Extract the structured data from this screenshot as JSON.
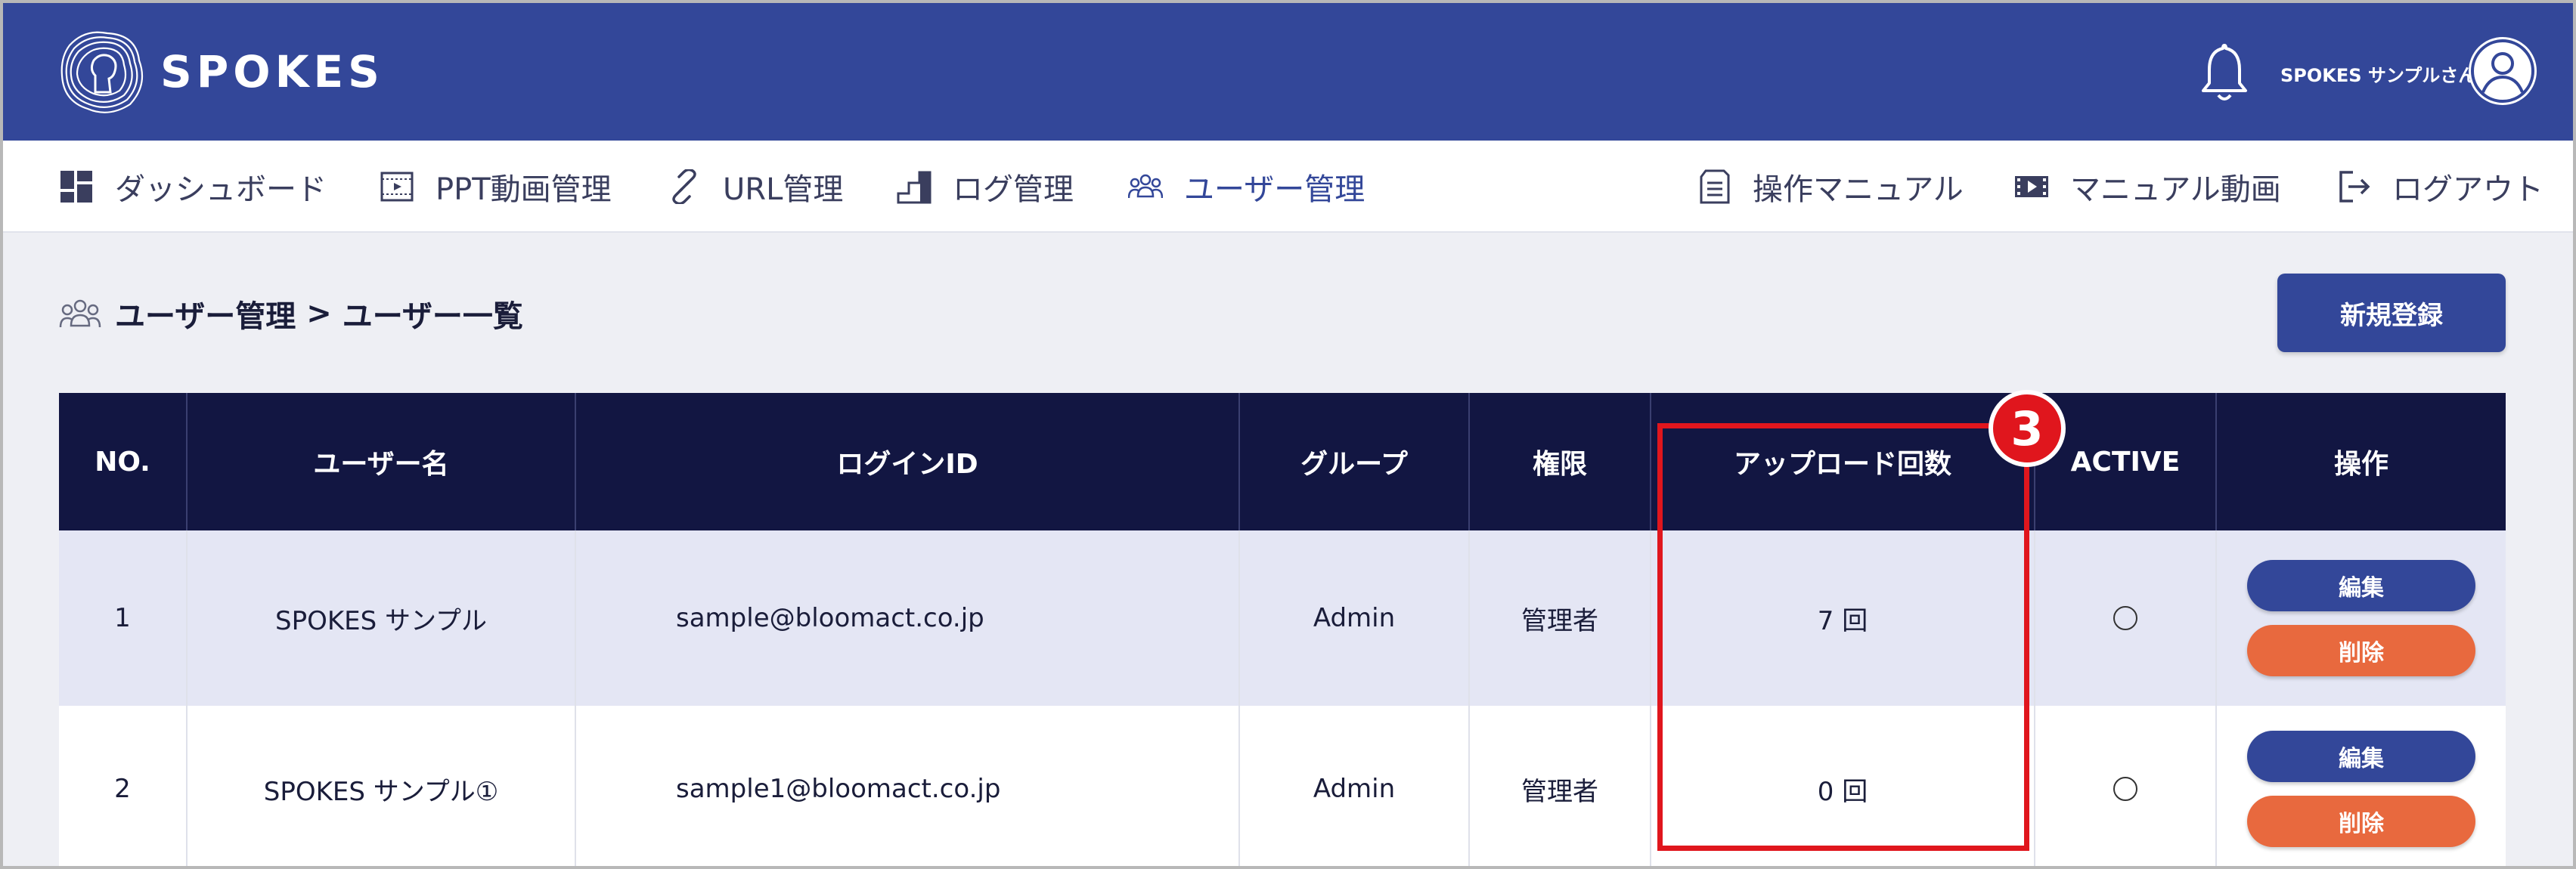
{
  "header": {
    "logo_text": "SPOKES",
    "user_name": "SPOKES サンプルさん"
  },
  "nav": {
    "items": [
      {
        "label": "ダッシュボード",
        "icon": "dashboard-icon"
      },
      {
        "label": "PPT動画管理",
        "icon": "video-file-icon"
      },
      {
        "label": "URL管理",
        "icon": "link-icon"
      },
      {
        "label": "ログ管理",
        "icon": "log-stairs-icon"
      },
      {
        "label": "ユーザー管理",
        "icon": "users-icon",
        "active": true
      }
    ],
    "right_items": [
      {
        "label": "操作マニュアル",
        "icon": "document-icon"
      },
      {
        "label": "マニュアル動画",
        "icon": "film-icon"
      },
      {
        "label": "ログアウト",
        "icon": "logout-icon"
      }
    ]
  },
  "page": {
    "breadcrumb_parent": "ユーザー管理",
    "breadcrumb_separator": ">",
    "breadcrumb_current": "ユーザー一覧",
    "new_button": "新規登録"
  },
  "table": {
    "headers": [
      "NO.",
      "ユーザー名",
      "ログインID",
      "グループ",
      "権限",
      "アップロード回数",
      "ACTIVE",
      "操作"
    ],
    "rows": [
      {
        "no": "1",
        "name": "SPOKES サンプル",
        "login_id": "sample@bloomact.co.jp",
        "group": "Admin",
        "role": "管理者",
        "uploads": "7 回",
        "active": "○",
        "edit": "編集",
        "delete": "削除"
      },
      {
        "no": "2",
        "name": "SPOKES サンプル①",
        "login_id": "sample1@bloomact.co.jp",
        "group": "Admin",
        "role": "管理者",
        "uploads": "0 回",
        "active": "○",
        "edit": "編集",
        "delete": "削除"
      }
    ]
  },
  "annotation": {
    "badge_number": "3",
    "color": "#e0161d"
  },
  "colors": {
    "brand": "#334799",
    "table_header": "#121642",
    "delete": "#e8693e"
  }
}
